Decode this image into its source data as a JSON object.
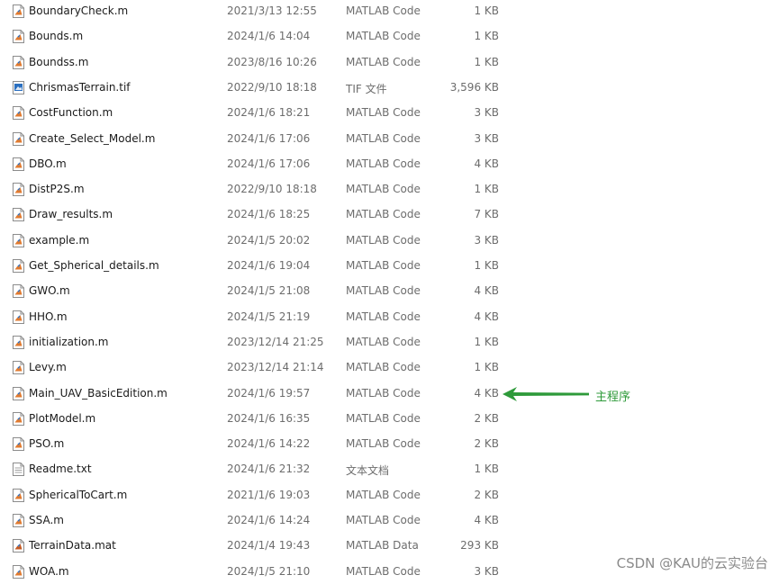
{
  "files": [
    {
      "name": "BoundaryCheck.m",
      "date": "2021/3/13 12:55",
      "type": "MATLAB Code",
      "size": "1 KB",
      "icon": "matlab-code-file-icon"
    },
    {
      "name": "Bounds.m",
      "date": "2024/1/6 14:04",
      "type": "MATLAB Code",
      "size": "1 KB",
      "icon": "matlab-code-file-icon"
    },
    {
      "name": "Boundss.m",
      "date": "2023/8/16 10:26",
      "type": "MATLAB Code",
      "size": "1 KB",
      "icon": "matlab-code-file-icon"
    },
    {
      "name": "ChrismasTerrain.tif",
      "date": "2022/9/10 18:18",
      "type": "TIF 文件",
      "size": "3,596 KB",
      "icon": "image-file-icon"
    },
    {
      "name": "CostFunction.m",
      "date": "2024/1/6 18:21",
      "type": "MATLAB Code",
      "size": "3 KB",
      "icon": "matlab-code-file-icon"
    },
    {
      "name": "Create_Select_Model.m",
      "date": "2024/1/6 17:06",
      "type": "MATLAB Code",
      "size": "3 KB",
      "icon": "matlab-code-file-icon"
    },
    {
      "name": "DBO.m",
      "date": "2024/1/6 17:06",
      "type": "MATLAB Code",
      "size": "4 KB",
      "icon": "matlab-code-file-icon"
    },
    {
      "name": "DistP2S.m",
      "date": "2022/9/10 18:18",
      "type": "MATLAB Code",
      "size": "1 KB",
      "icon": "matlab-code-file-icon"
    },
    {
      "name": "Draw_results.m",
      "date": "2024/1/6 18:25",
      "type": "MATLAB Code",
      "size": "7 KB",
      "icon": "matlab-code-file-icon"
    },
    {
      "name": "example.m",
      "date": "2024/1/5 20:02",
      "type": "MATLAB Code",
      "size": "3 KB",
      "icon": "matlab-code-file-icon"
    },
    {
      "name": "Get_Spherical_details.m",
      "date": "2024/1/6 19:04",
      "type": "MATLAB Code",
      "size": "1 KB",
      "icon": "matlab-code-file-icon"
    },
    {
      "name": "GWO.m",
      "date": "2024/1/5 21:08",
      "type": "MATLAB Code",
      "size": "4 KB",
      "icon": "matlab-code-file-icon"
    },
    {
      "name": "HHO.m",
      "date": "2024/1/5 21:19",
      "type": "MATLAB Code",
      "size": "4 KB",
      "icon": "matlab-code-file-icon"
    },
    {
      "name": "initialization.m",
      "date": "2023/12/14 21:25",
      "type": "MATLAB Code",
      "size": "1 KB",
      "icon": "matlab-code-file-icon"
    },
    {
      "name": "Levy.m",
      "date": "2023/12/14 21:14",
      "type": "MATLAB Code",
      "size": "1 KB",
      "icon": "matlab-code-file-icon"
    },
    {
      "name": "Main_UAV_BasicEdition.m",
      "date": "2024/1/6 19:57",
      "type": "MATLAB Code",
      "size": "4 KB",
      "icon": "matlab-code-file-icon"
    },
    {
      "name": "PlotModel.m",
      "date": "2024/1/6 16:35",
      "type": "MATLAB Code",
      "size": "2 KB",
      "icon": "matlab-code-file-icon"
    },
    {
      "name": "PSO.m",
      "date": "2024/1/6 14:22",
      "type": "MATLAB Code",
      "size": "2 KB",
      "icon": "matlab-code-file-icon"
    },
    {
      "name": "Readme.txt",
      "date": "2024/1/6 21:32",
      "type": "文本文档",
      "size": "1 KB",
      "icon": "text-file-icon"
    },
    {
      "name": "SphericalToCart.m",
      "date": "2021/1/6 19:03",
      "type": "MATLAB Code",
      "size": "2 KB",
      "icon": "matlab-code-file-icon"
    },
    {
      "name": "SSA.m",
      "date": "2024/1/6 14:24",
      "type": "MATLAB Code",
      "size": "4 KB",
      "icon": "matlab-code-file-icon"
    },
    {
      "name": "TerrainData.mat",
      "date": "2024/1/4 19:43",
      "type": "MATLAB Data",
      "size": "293 KB",
      "icon": "matlab-data-file-icon"
    },
    {
      "name": "WOA.m",
      "date": "2024/1/5 21:10",
      "type": "MATLAB Code",
      "size": "3 KB",
      "icon": "matlab-code-file-icon"
    }
  ],
  "annotation": {
    "label": "主程序",
    "color": "#2e9a3a"
  },
  "watermark": "CSDN @KAU的云实验台",
  "colors": {
    "text": "#1a1a1a",
    "secondary_text": "#6d6d6d",
    "background": "#ffffff"
  }
}
